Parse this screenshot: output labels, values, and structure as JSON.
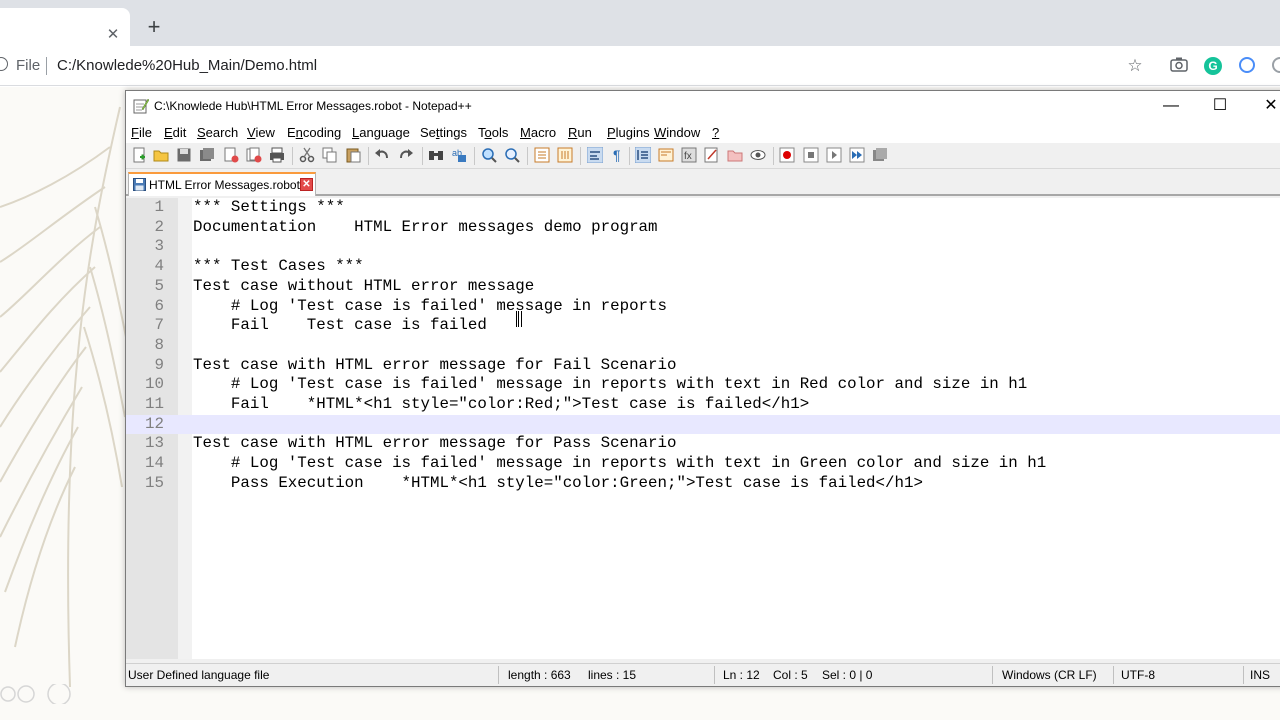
{
  "browser": {
    "tab_close": "✕",
    "new_tab": "+",
    "file_label": "File",
    "url": "C:/Knowlede%20Hub_Main/Demo.html",
    "icons": [
      "info-icon",
      "star-icon",
      "camera-icon",
      "grammarly-icon",
      "extension-icon"
    ]
  },
  "npp": {
    "title": "C:\\Knowlede Hub\\HTML Error Messages.robot - Notepad++",
    "window_buttons": {
      "minimize": "—",
      "maximize": "☐",
      "close": "✕"
    },
    "menu": [
      {
        "label": "File",
        "u": "F"
      },
      {
        "label": "Edit",
        "u": "E"
      },
      {
        "label": "Search",
        "u": "S"
      },
      {
        "label": "View",
        "u": "V"
      },
      {
        "label": "Encoding",
        "u": "n"
      },
      {
        "label": "Language",
        "u": "L"
      },
      {
        "label": "Settings",
        "u": "t"
      },
      {
        "label": "Tools",
        "u": "o"
      },
      {
        "label": "Macro",
        "u": "M"
      },
      {
        "label": "Run",
        "u": "R"
      },
      {
        "label": "Plugins",
        "u": "P"
      },
      {
        "label": "Window",
        "u": "W"
      },
      {
        "label": "?",
        "u": "?"
      }
    ],
    "tab": {
      "label": "HTML Error Messages.robot",
      "close": "✕"
    },
    "current_line": 12,
    "lines": [
      {
        "n": "1",
        "text": "*** Settings ***"
      },
      {
        "n": "2",
        "text": "Documentation    HTML Error messages demo program"
      },
      {
        "n": "3",
        "text": ""
      },
      {
        "n": "4",
        "text": "*** Test Cases ***"
      },
      {
        "n": "5",
        "text": "Test case without HTML error message"
      },
      {
        "n": "6",
        "text": "    # Log 'Test case is failed' message in reports"
      },
      {
        "n": "7",
        "text": "    Fail    Test case is failed"
      },
      {
        "n": "8",
        "text": ""
      },
      {
        "n": "9",
        "text": "Test case with HTML error message for Fail Scenario"
      },
      {
        "n": "10",
        "text": "    # Log 'Test case is failed' message in reports with text in Red color and size in h1"
      },
      {
        "n": "11",
        "text": "    Fail    *HTML*<h1 style=\"color:Red;\">Test case is failed</h1>"
      },
      {
        "n": "12",
        "text": ""
      },
      {
        "n": "13",
        "text": "Test case with HTML error message for Pass Scenario"
      },
      {
        "n": "14",
        "text": "    # Log 'Test case is failed' message in reports with text in Green color and size in h1"
      },
      {
        "n": "15",
        "text": "    Pass Execution    *HTML*<h1 style=\"color:Green;\">Test case is failed</h1>"
      }
    ],
    "status": {
      "file_type": "User Defined language file",
      "length": "length : 663",
      "lines": "lines : 15",
      "ln": "Ln : 12",
      "col": "Col : 5",
      "sel": "Sel : 0 | 0",
      "eol": "Windows (CR LF)",
      "encoding": "UTF-8",
      "mode": "INS"
    },
    "colors": {
      "current_line": "#e8e8ff",
      "gutter": "#e4e4e4",
      "tab_accent": "#fa9b3d"
    }
  }
}
